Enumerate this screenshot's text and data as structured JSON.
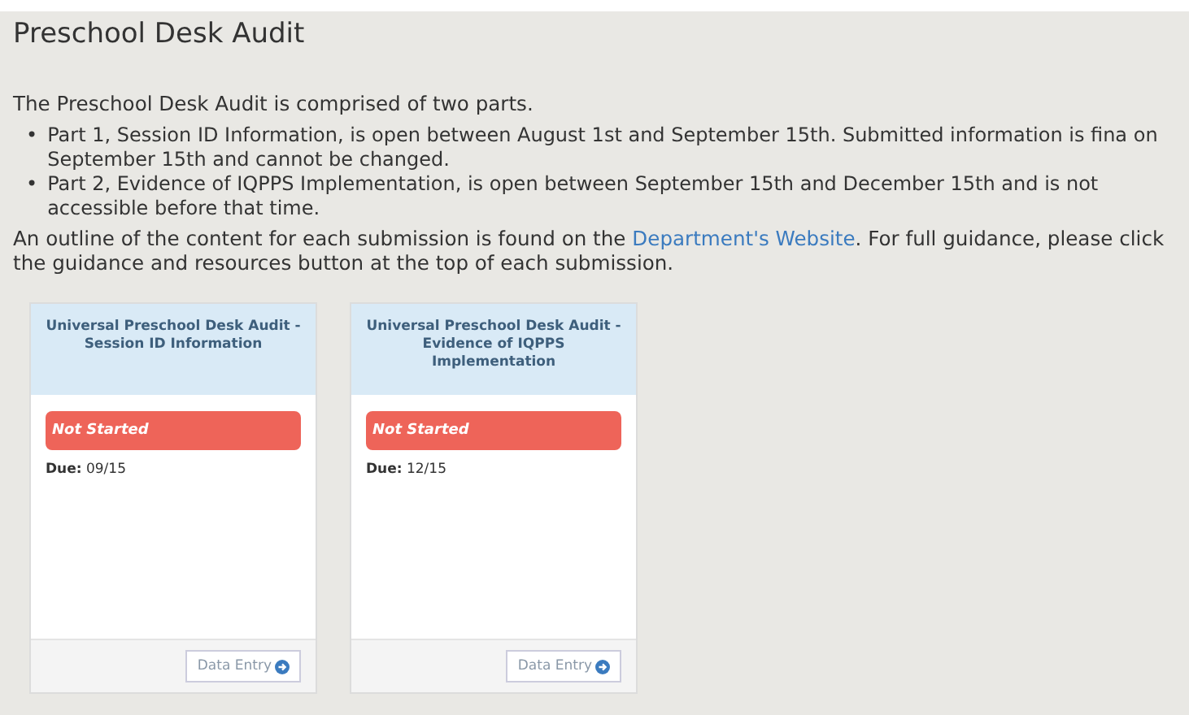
{
  "title": "Preschool Desk Audit",
  "intro": "The Preschool Desk Audit is comprised of two parts.",
  "bullets": [
    {
      "marker": "•",
      "text": "Part 1, Session ID Information, is open between August 1st and September 15th. Submitted information is fina on September 15th and cannot be changed."
    },
    {
      "marker": "•",
      "text": "Part 2, Evidence of IQPPS Implementation, is open between September 15th and December 15th and is not accessible before that time."
    }
  ],
  "outline": {
    "before": "An outline of the content for each submission is found on the",
    "link": "Department's Website",
    "after": ". For full guidance, please click the guidance and resources button at the top of each submission."
  },
  "cards": [
    {
      "title": "Universal Preschool Desk Audit - Session ID Information",
      "status": {
        "kind": "not_started",
        "label": "Not Started"
      },
      "due_label": "Due:",
      "due": "09/15",
      "button": "Data Entry"
    },
    {
      "title": "Universal Preschool Desk Audit - Evidence of IQPPS Implementation",
      "status": {
        "kind": "not_started",
        "label": "Not Started"
      },
      "due_label": "Due:",
      "due": "12/15",
      "button": "Data Entry"
    }
  ]
}
